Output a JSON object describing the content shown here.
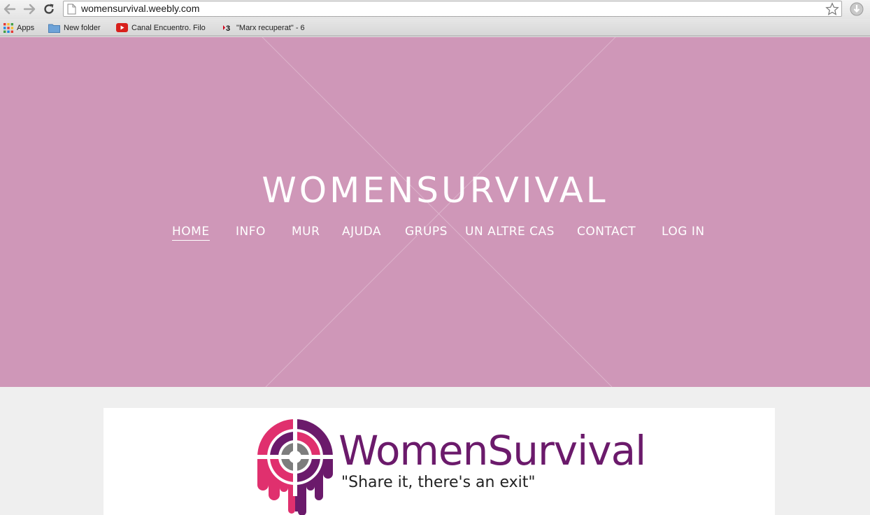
{
  "browser": {
    "url": "womensurvival.weebly.com",
    "bookmarks": [
      {
        "label": "Apps",
        "icon": "apps-grid-icon"
      },
      {
        "label": "New folder",
        "icon": "folder-icon"
      },
      {
        "label": "Canal Encuentro. Filo",
        "icon": "youtube-icon"
      },
      {
        "label": "\"Marx recuperat\" - 6",
        "icon": "tv3-icon"
      }
    ]
  },
  "site": {
    "title": "WOMENSURVIVAL",
    "hero_color": "#cf97b8",
    "nav": [
      "HOME",
      "INFO",
      "MUR",
      "AJUDA",
      "GRUPS",
      "UN ALTRE CAS",
      "CONTACT",
      "LOG IN"
    ],
    "active_nav": "HOME"
  },
  "logo": {
    "name": "WomenSurvival",
    "tagline": "\"Share it, there's an exit\"",
    "colors": {
      "purple": "#6b1a6b",
      "pink": "#e0306e",
      "gray": "#7d7d7d"
    }
  }
}
